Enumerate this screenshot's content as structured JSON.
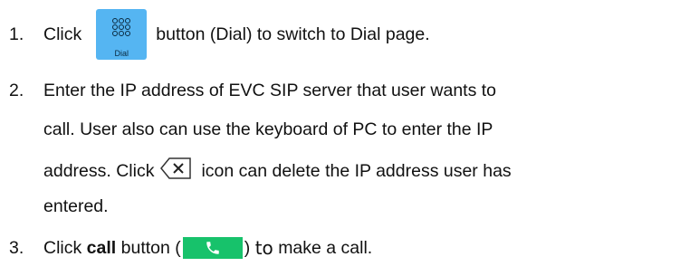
{
  "steps": [
    {
      "number": "1.",
      "pre": "Click",
      "icon_label": "Dial",
      "post": "button (Dial) to switch to Dial page."
    },
    {
      "number": "2.",
      "line1": "Enter the IP address of EVC SIP server that user wants to",
      "line2": "call. User also can use the keyboard of PC to enter the IP",
      "line3_pre": "address. Click",
      "line3_post": "icon can delete the IP address user has",
      "line4": "entered."
    },
    {
      "number": "3.",
      "pre": "Click",
      "bold": "call",
      "mid": "button (",
      "post_close": ")",
      "to_word": "to",
      "tail": "make a call."
    }
  ],
  "colors": {
    "dial_button": "#55b5f2",
    "call_button": "#17c26b"
  },
  "icons": [
    "dial-keypad-icon",
    "backspace-delete-icon",
    "phone-handset-icon"
  ]
}
